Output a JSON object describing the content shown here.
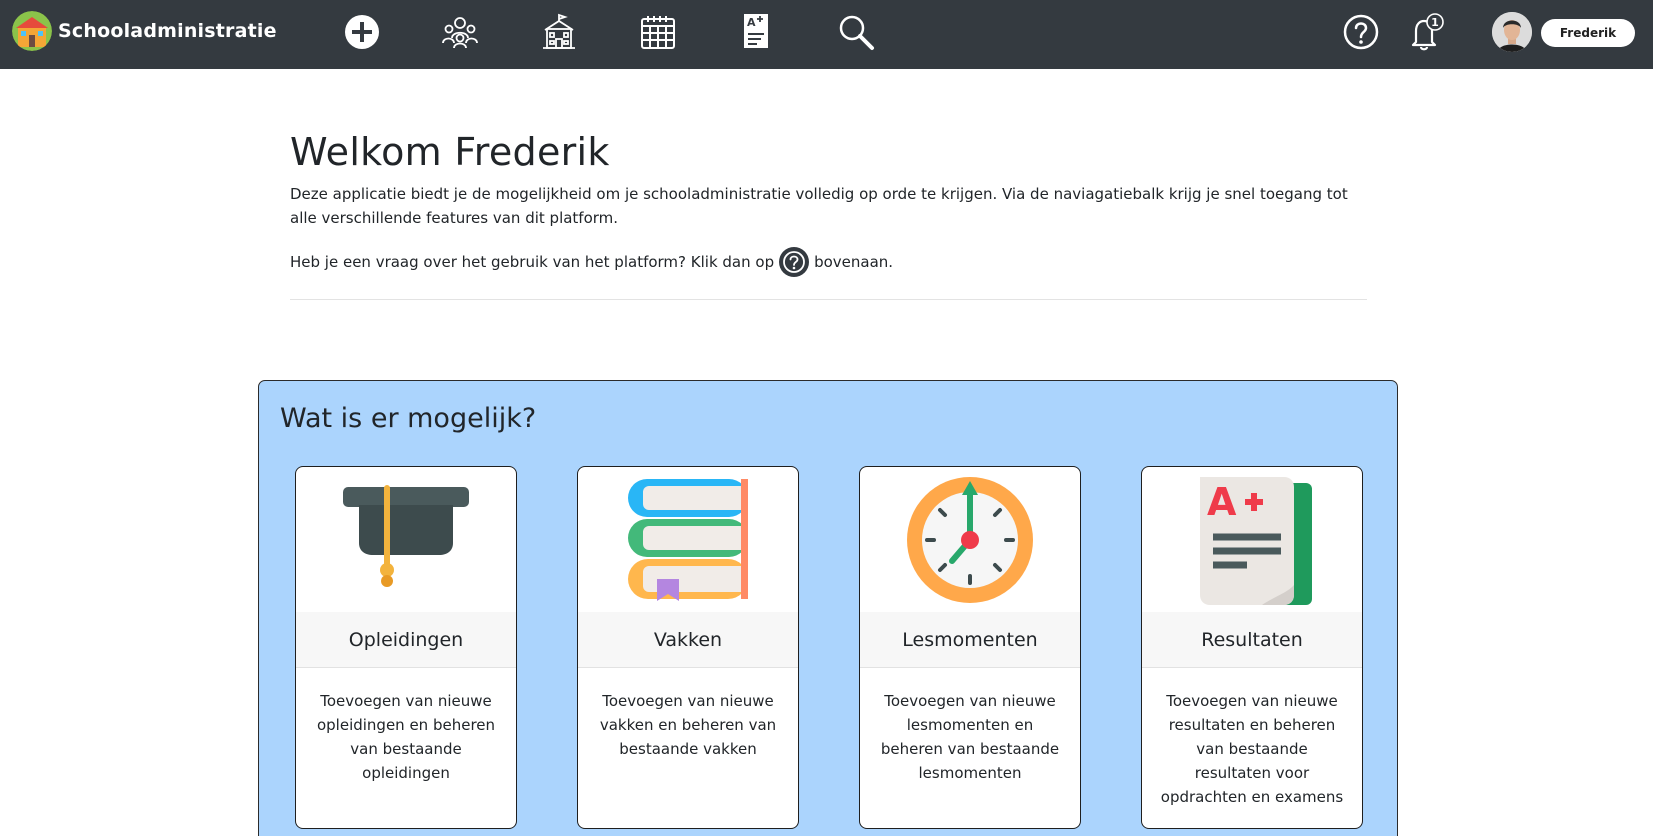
{
  "app": {
    "title": "Schooladministratie"
  },
  "nav": {
    "icons": [
      "plus-circle-icon",
      "users-group-icon",
      "school-building-icon",
      "calendar-icon",
      "grade-sheet-icon",
      "search-icon",
      "help-circle-icon",
      "bell-icon"
    ],
    "notification_count": "1",
    "user_name": "Frederik"
  },
  "welcome": {
    "title": "Welkom Frederik",
    "intro": "Deze applicatie biedt je de mogelijkheid om je schooladministratie volledig op orde te krijgen. Via de naviagatiebalk krijg je snel toegang tot alle verschillende features van dit platform.",
    "help_before": "Heb je een vraag over het gebruik van het platform? Klik dan op",
    "help_after": "bovenaan."
  },
  "features": {
    "title": "Wat is er mogelijk?",
    "cards": [
      {
        "title": "Opleidingen",
        "description": "Toevoegen van nieuwe opleidingen en beheren van bestaande opleidingen",
        "icon": "graduation-cap-icon"
      },
      {
        "title": "Vakken",
        "description": "Toevoegen van nieuwe vakken en beheren van bestaande vakken",
        "icon": "books-icon"
      },
      {
        "title": "Lesmomenten",
        "description": "Toevoegen van nieuwe lesmomenten en beheren van bestaande lesmomenten",
        "icon": "clock-icon"
      },
      {
        "title": "Resultaten",
        "description": "Toevoegen van nieuwe resultaten en beheren van bestaande resultaten voor opdrachten en examens",
        "icon": "grade-report-icon"
      }
    ]
  },
  "colors": {
    "navbar": "#343a40",
    "panel": "#abd4fd",
    "card_header": "#f7f7f7"
  }
}
